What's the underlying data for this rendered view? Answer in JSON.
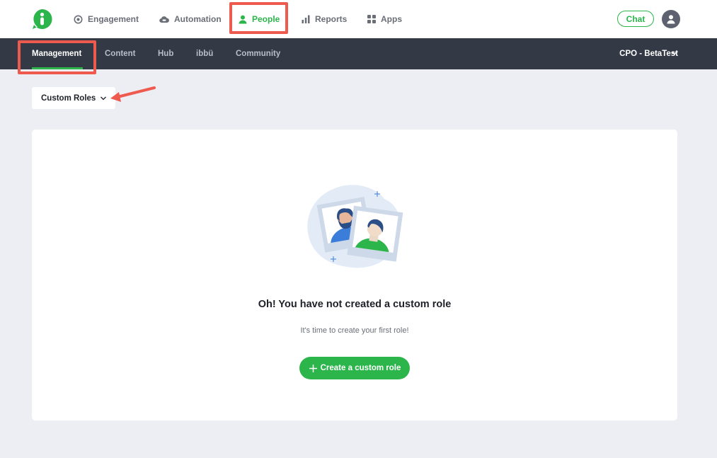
{
  "topnav": {
    "items": [
      {
        "label": "Engagement",
        "icon": "target-icon"
      },
      {
        "label": "Automation",
        "icon": "cloud-icon"
      },
      {
        "label": "People",
        "icon": "person-icon",
        "active": true
      },
      {
        "label": "Reports",
        "icon": "bar-chart-icon"
      },
      {
        "label": "Apps",
        "icon": "grid-icon"
      }
    ],
    "chat_label": "Chat"
  },
  "subnav": {
    "items": [
      {
        "label": "Management",
        "active": true
      },
      {
        "label": "Content"
      },
      {
        "label": "Hub"
      },
      {
        "label": "ibbü"
      },
      {
        "label": "Community"
      }
    ],
    "account_label": "CPO - BetaTest"
  },
  "filter": {
    "selected": "Custom Roles"
  },
  "empty_state": {
    "title": "Oh! You have not created a custom role",
    "subtitle": "It's time to create your first role!",
    "button_label": "Create a custom role"
  },
  "colors": {
    "brand_green": "#2bb54a",
    "subnav_bg": "#333945",
    "highlight": "#ef5a4f"
  }
}
